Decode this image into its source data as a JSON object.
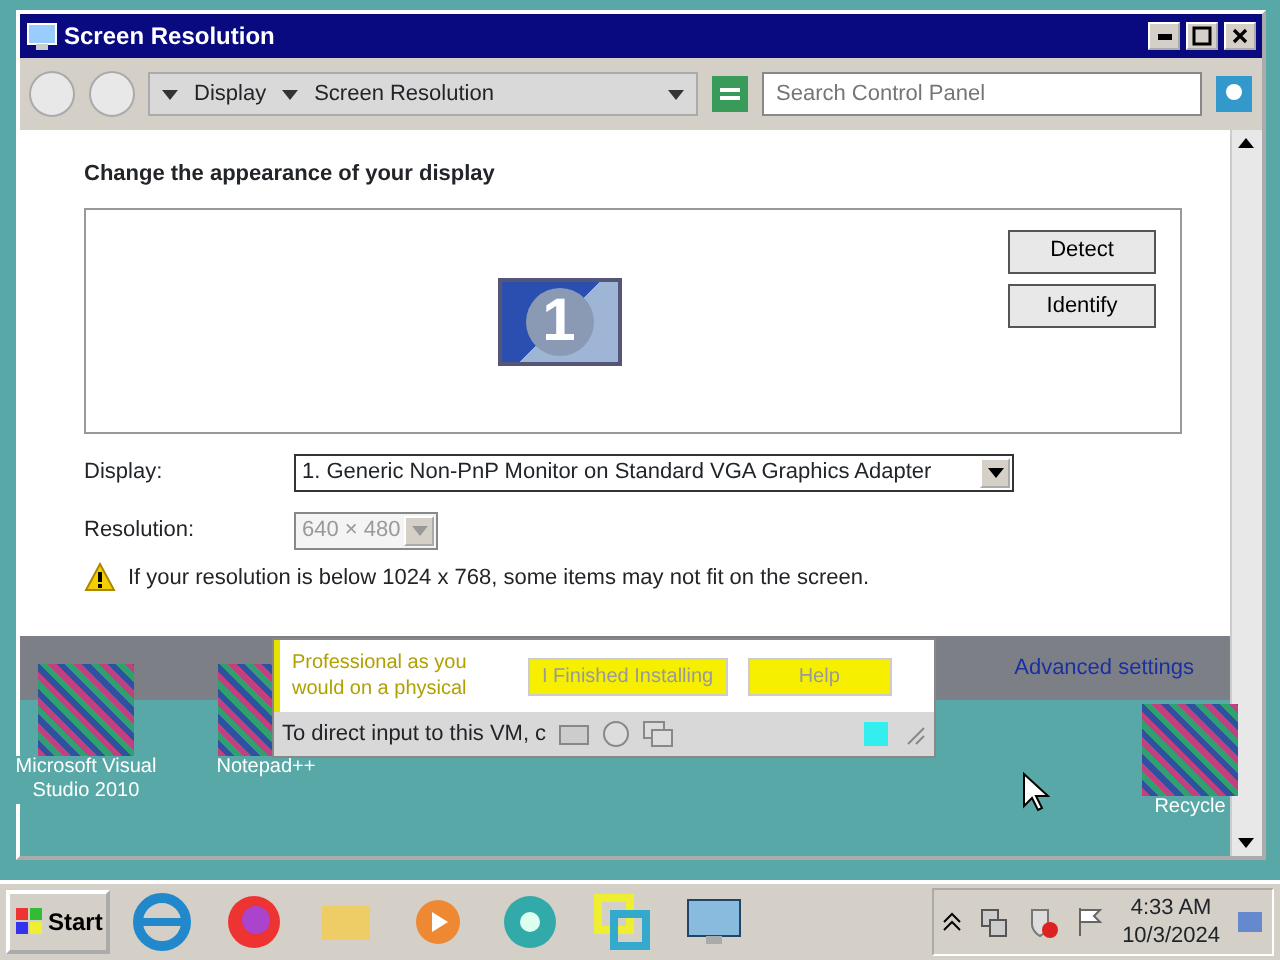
{
  "window": {
    "title": "Screen Resolution"
  },
  "address_bar": {
    "breadcrumbs": [
      "Display",
      "Screen Resolution"
    ]
  },
  "search": {
    "placeholder": "Search Control Panel"
  },
  "heading": "Change the appearance of your display",
  "monitor": {
    "label": "1"
  },
  "monitor_buttons": [
    "Detect",
    "Identify"
  ],
  "fields": [
    {
      "label": "Display:",
      "value": "1. Generic Non-PnP Monitor on Standard VGA Graphics Adapter",
      "disabled": false
    },
    {
      "label": "Resolution:",
      "value": "640 × 480",
      "disabled": true
    }
  ],
  "warning": "If your resolution is below 1024 x 768, some items may not fit on the screen.",
  "advanced_link": "Advanced settings",
  "vm_popup": {
    "message": "Professional as you would on a physical",
    "buttons": [
      "I Finished Installing",
      "Help"
    ],
    "status": "To direct input to this VM, c"
  },
  "desktop_icons": [
    {
      "label": "Microsoft Visual Studio 2010"
    },
    {
      "label": "Notepad++"
    },
    {
      "label": "Recycle"
    }
  ],
  "taskbar": {
    "start": "Start",
    "time": "4:33 AM",
    "date": "10/3/2024"
  }
}
